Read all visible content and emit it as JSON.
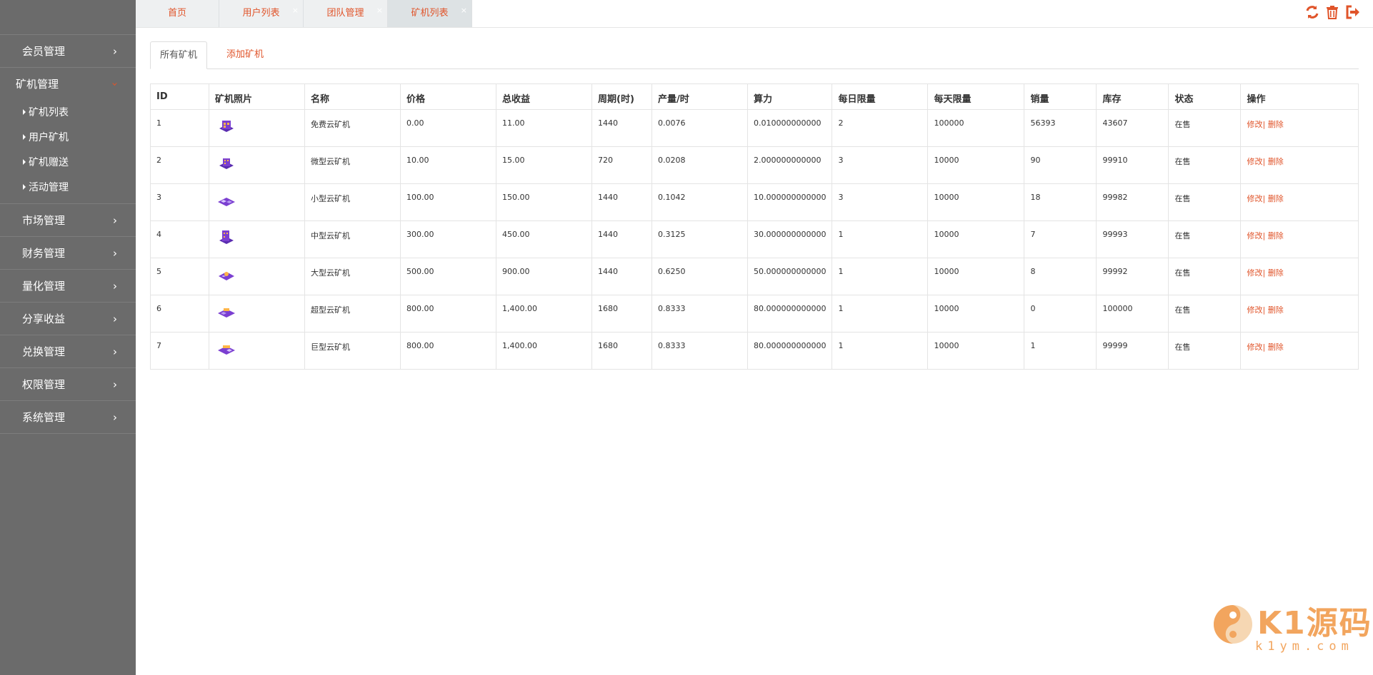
{
  "sidebar": {
    "items": [
      {
        "label": "会员管理"
      },
      {
        "label": "矿机管理"
      },
      {
        "label": "市场管理"
      },
      {
        "label": "财务管理"
      },
      {
        "label": "量化管理"
      },
      {
        "label": "分享收益"
      },
      {
        "label": "兑换管理"
      },
      {
        "label": "权限管理"
      },
      {
        "label": "系统管理"
      }
    ],
    "sub_items": [
      {
        "label": "矿机列表"
      },
      {
        "label": "用户矿机"
      },
      {
        "label": "矿机赠送"
      },
      {
        "label": "活动管理"
      }
    ]
  },
  "tabs": [
    {
      "label": "首页"
    },
    {
      "label": "用户列表",
      "close": "×"
    },
    {
      "label": "团队管理",
      "close": "×"
    },
    {
      "label": "矿机列表",
      "close": "×"
    }
  ],
  "subtabs": {
    "all": "所有矿机",
    "add": "添加矿机"
  },
  "table": {
    "headers": [
      "ID",
      "矿机照片",
      "名称",
      "价格",
      "总收益",
      "周期(时)",
      "产量/时",
      "算力",
      "每日限量",
      "每天限量",
      "销量",
      "库存",
      "状态",
      "操作"
    ],
    "rows": [
      {
        "id": "1",
        "name": "免费云矿机",
        "price": "0.00",
        "total": "11.00",
        "cycle": "1440",
        "output": "0.0076",
        "power": "0.010000000000",
        "daily": "2",
        "daylimit": "100000",
        "sales": "56393",
        "stock": "43607",
        "status": "在售",
        "edit": "修改|",
        "del": " 删除"
      },
      {
        "id": "2",
        "name": "微型云矿机",
        "price": "10.00",
        "total": "15.00",
        "cycle": "720",
        "output": "0.0208",
        "power": "2.000000000000",
        "daily": "3",
        "daylimit": "10000",
        "sales": "90",
        "stock": "99910",
        "status": "在售",
        "edit": "修改|",
        "del": " 删除"
      },
      {
        "id": "3",
        "name": "小型云矿机",
        "price": "100.00",
        "total": "150.00",
        "cycle": "1440",
        "output": "0.1042",
        "power": "10.000000000000",
        "daily": "3",
        "daylimit": "10000",
        "sales": "18",
        "stock": "99982",
        "status": "在售",
        "edit": "修改|",
        "del": " 删除"
      },
      {
        "id": "4",
        "name": "中型云矿机",
        "price": "300.00",
        "total": "450.00",
        "cycle": "1440",
        "output": "0.3125",
        "power": "30.000000000000",
        "daily": "1",
        "daylimit": "10000",
        "sales": "7",
        "stock": "99993",
        "status": "在售",
        "edit": "修改|",
        "del": " 删除"
      },
      {
        "id": "5",
        "name": "大型云矿机",
        "price": "500.00",
        "total": "900.00",
        "cycle": "1440",
        "output": "0.6250",
        "power": "50.000000000000",
        "daily": "1",
        "daylimit": "10000",
        "sales": "8",
        "stock": "99992",
        "status": "在售",
        "edit": "修改|",
        "del": " 删除"
      },
      {
        "id": "6",
        "name": "超型云矿机",
        "price": "800.00",
        "total": "1,400.00",
        "cycle": "1680",
        "output": "0.8333",
        "power": "80.000000000000",
        "daily": "1",
        "daylimit": "10000",
        "sales": "0",
        "stock": "100000",
        "status": "在售",
        "edit": "修改|",
        "del": " 删除"
      },
      {
        "id": "7",
        "name": "巨型云矿机",
        "price": "800.00",
        "total": "1,400.00",
        "cycle": "1680",
        "output": "0.8333",
        "power": "80.000000000000",
        "daily": "1",
        "daylimit": "10000",
        "sales": "1",
        "stock": "99999",
        "status": "在售",
        "edit": "修改|",
        "del": " 删除"
      }
    ]
  },
  "watermark": {
    "main": "K1源码",
    "sub": "k1ym.com"
  },
  "colors": {
    "accent": "#e0542a",
    "sidebar": "#6b6b6b",
    "product": "#7b3fd1"
  }
}
